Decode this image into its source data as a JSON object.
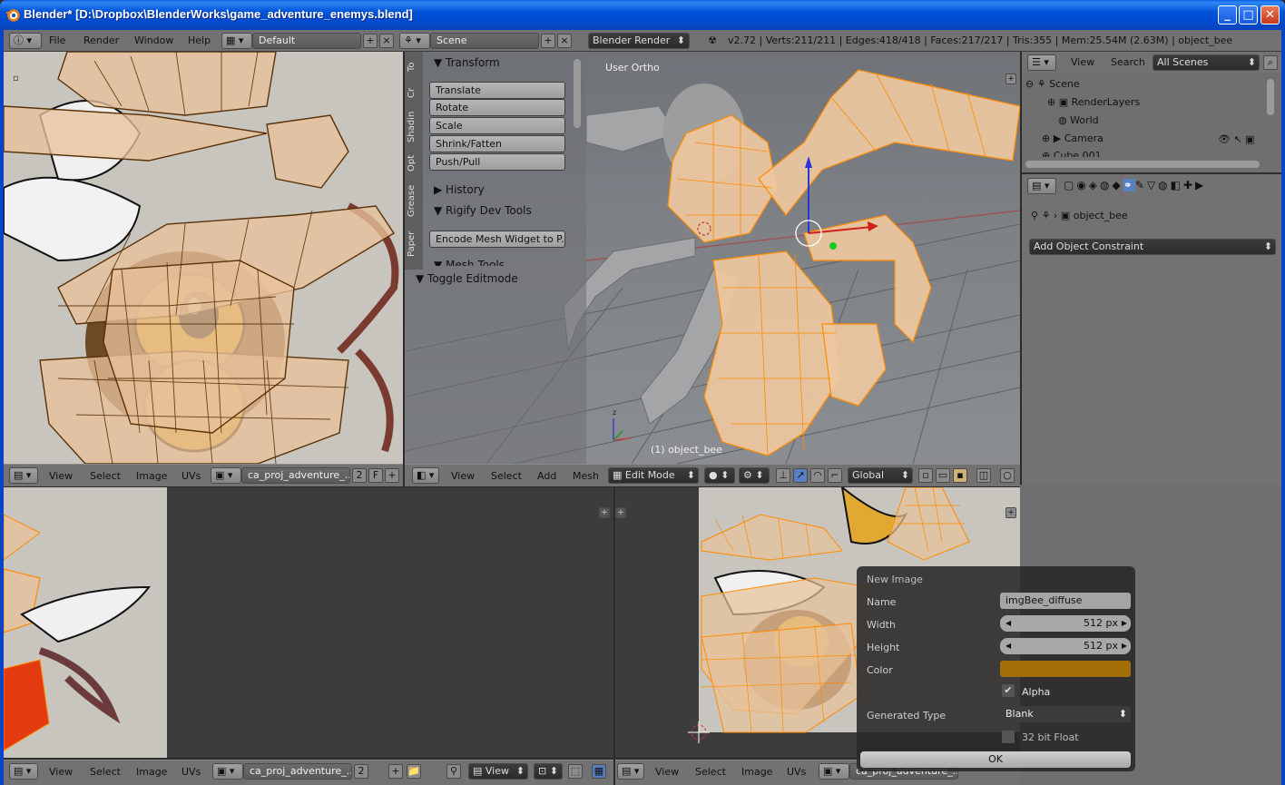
{
  "window": {
    "title": "Blender* [D:\\Dropbox\\BlenderWorks\\game_adventure_enemys.blend]",
    "minimize": "_",
    "maximize": "□",
    "close": "✕"
  },
  "info": {
    "menus": [
      "File",
      "Render",
      "Window",
      "Help"
    ],
    "layout": "Default",
    "scene": "Scene",
    "engine": "Blender Render",
    "stats": "v2.72 | Verts:211/211 | Edges:418/418 | Faces:217/217 | Tris:355 | Mem:25.54M (2.63M) | object_bee"
  },
  "uv_top": {
    "menus": [
      "View",
      "Select",
      "Image",
      "UVs"
    ],
    "image": "ca_proj_adventure_...",
    "users": "2",
    "fake": "F"
  },
  "toolshelf": {
    "tabs": [
      "To",
      "Cr",
      "Shadin",
      "Opt",
      "Grease",
      "Paper"
    ],
    "transform_title": "Transform",
    "buttons": [
      "Translate",
      "Rotate",
      "Scale",
      "Shrink/Fatten",
      "Push/Pull"
    ],
    "history": "History",
    "rigify": "Rigify Dev Tools",
    "encode": "Encode Mesh Widget to P...",
    "mesh_tools": "Mesh Tools",
    "toggle": "Toggle Editmode"
  },
  "viewport": {
    "label": "User Ortho",
    "object": "(1) object_bee",
    "menus": [
      "View",
      "Select",
      "Add",
      "Mesh"
    ],
    "mode": "Edit Mode",
    "orientation": "Global"
  },
  "outliner": {
    "menus": [
      "View",
      "Search"
    ],
    "filter": "All Scenes",
    "items": [
      "Scene",
      "RenderLayers",
      "World",
      "Camera",
      "Cube.001"
    ]
  },
  "properties": {
    "object": "object_bee",
    "constraint_button": "Add Object Constraint"
  },
  "uv_bottom_left": {
    "menus": [
      "View",
      "Select",
      "Image",
      "UVs"
    ],
    "image": "ca_proj_adventure_...",
    "users": "2",
    "view": "View"
  },
  "uv_bottom_right": {
    "menus": [
      "View",
      "Select",
      "Image",
      "UVs"
    ],
    "image": "ca_proj_adventure_..."
  },
  "new_image": {
    "title": "New Image",
    "name_label": "Name",
    "name_value": "imgBee_diffuse",
    "width_label": "Width",
    "width_value": "512 px",
    "height_label": "Height",
    "height_value": "512 px",
    "color_label": "Color",
    "color": "#a36e08",
    "alpha_label": "Alpha",
    "gen_label": "Generated Type",
    "gen_value": "Blank",
    "float_label": "32 bit Float",
    "ok": "OK"
  },
  "colors": {
    "mesh_orange": "#ff8a00",
    "face_fill": "#e8c29b"
  }
}
